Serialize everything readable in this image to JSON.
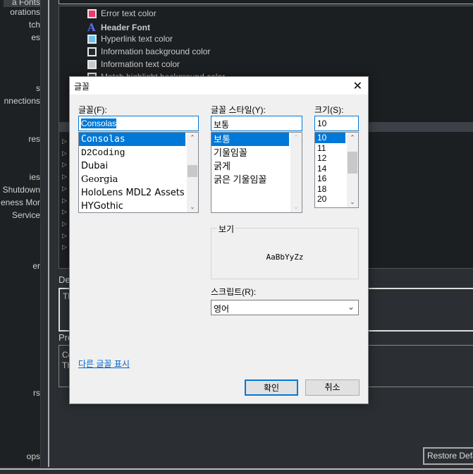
{
  "sidebar": {
    "items": [
      {
        "label": "a Fonts",
        "selected": true
      },
      {
        "label": "orations"
      },
      {
        "label": "tch"
      },
      {
        "label": "es"
      },
      {
        "label": "s"
      },
      {
        "label": "nnections"
      },
      {
        "label": "res"
      },
      {
        "label": "ies"
      },
      {
        "label": "Shutdown"
      },
      {
        "label": "eness Mor"
      },
      {
        "label": "Service"
      },
      {
        "label": "er"
      },
      {
        "label": "rs"
      },
      {
        "label": "ops"
      }
    ]
  },
  "options": {
    "items": [
      {
        "label": "Error text color",
        "swatch": "#f0386b"
      },
      {
        "label": "Header Font",
        "icon": "font-icon",
        "bold": true
      },
      {
        "label": "Hyperlink text color",
        "swatch": "#6cc4f0"
      },
      {
        "label": "Information background color",
        "swatch": "#25282c"
      },
      {
        "label": "Information text color",
        "swatch": "#c8cacc"
      },
      {
        "label": "Match highlight background color",
        "swatch": "#444"
      }
    ]
  },
  "description": {
    "label": "De",
    "text": "Th"
  },
  "preview": {
    "label": "Pre",
    "lines": [
      "Co",
      "Th"
    ]
  },
  "restore_button": "Restore Defa",
  "dialog": {
    "title": "글꼴",
    "font_label": "글꼴(F):",
    "font_value": "Consolas",
    "fonts": [
      "Consolas",
      "D2Coding",
      "Dubai",
      "Georgia",
      "HoloLens MDL2 Assets",
      "HYGothic"
    ],
    "style_label": "글꼴 스타일(Y):",
    "style_value": "보통",
    "styles": [
      "보통",
      "기울임꼴",
      "굵게",
      "굵은 기울임꼴"
    ],
    "size_label": "크기(S):",
    "size_value": "10",
    "sizes": [
      "10",
      "11",
      "12",
      "14",
      "16",
      "18",
      "20"
    ],
    "sample_label": "보기",
    "sample_text": "AaBbYyZz",
    "script_label": "스크립트(R):",
    "script_value": "영어",
    "more_fonts_link": "다른 글꼴 표시",
    "ok": "확인",
    "cancel": "취소",
    "accent": "#0078d7"
  }
}
